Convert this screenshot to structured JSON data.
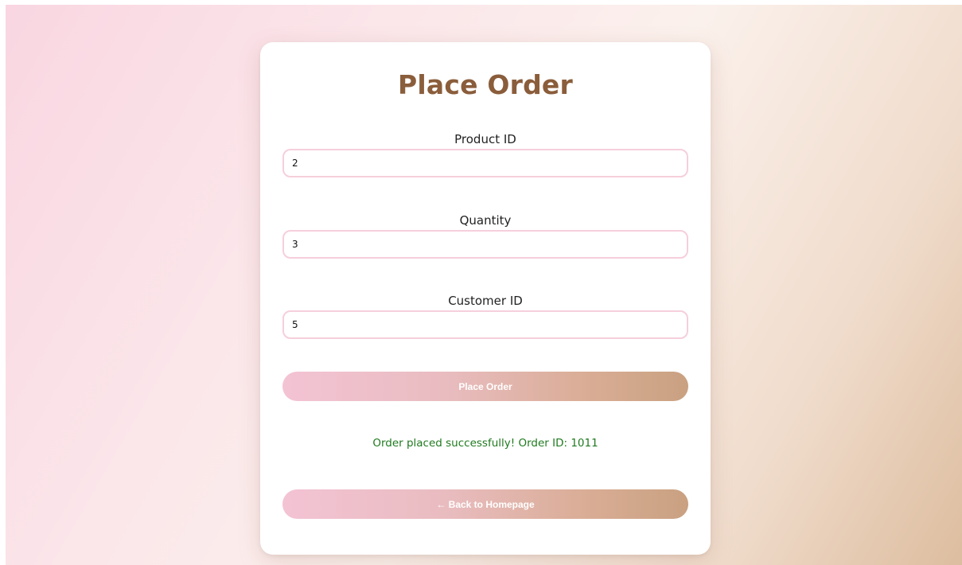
{
  "page": {
    "title": "Place Order"
  },
  "form": {
    "product_id": {
      "label": "Product ID",
      "value": "2"
    },
    "quantity": {
      "label": "Quantity",
      "value": "3"
    },
    "customer_id": {
      "label": "Customer ID",
      "value": "5"
    },
    "submit_label": "Place Order"
  },
  "status": {
    "message": "Order placed successfully! Order ID: 1011",
    "color": "#1f7a1f"
  },
  "navigation": {
    "back_label": "← Back to Homepage"
  },
  "colors": {
    "title": "#8a5d3b",
    "input_border": "#f6cfdb",
    "button_gradient_start": "#f3c3d4",
    "button_gradient_end": "#c9a181"
  }
}
